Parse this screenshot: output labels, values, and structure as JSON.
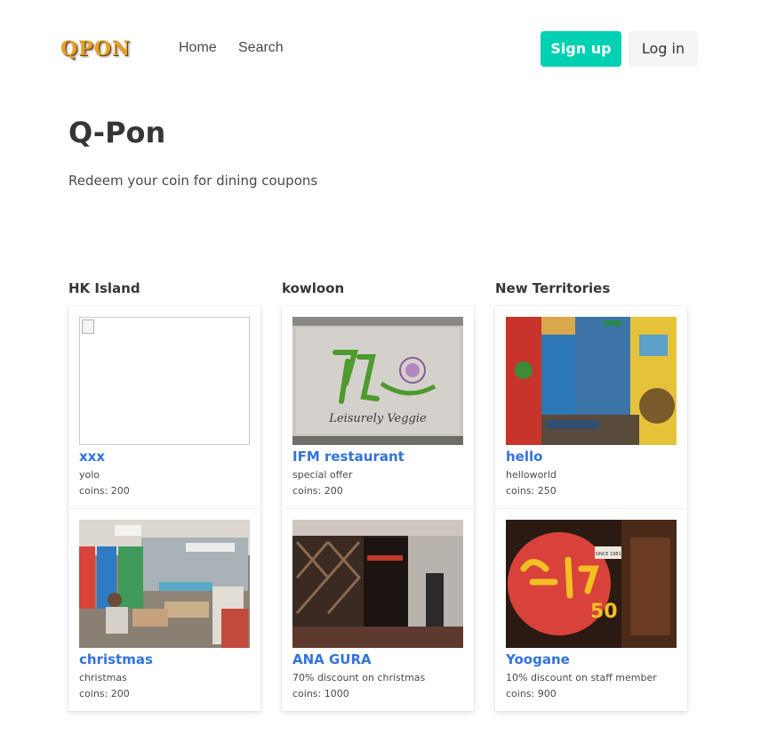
{
  "brand": {
    "logo_text": "QPON"
  },
  "nav": {
    "home": "Home",
    "search": "Search",
    "signup": "Sign up",
    "login": "Log in"
  },
  "hero": {
    "title": "Q-Pon",
    "subtitle": "Redeem your coin for dining coupons"
  },
  "columns": [
    {
      "title": "HK Island",
      "cards": [
        {
          "name": "xxx",
          "desc": "yolo",
          "coins": "coins: 200"
        },
        {
          "name": "christmas",
          "desc": "christmas",
          "coins": "coins: 200"
        }
      ]
    },
    {
      "title": "kowloon",
      "cards": [
        {
          "name": "IFM restaurant",
          "desc": "special offer",
          "coins": "coins: 200"
        },
        {
          "name": "ANA GURA",
          "desc": "70% discount on christmas",
          "coins": "coins: 1000"
        }
      ]
    },
    {
      "title": "New Territories",
      "cards": [
        {
          "name": "hello",
          "desc": "helloworld",
          "coins": "coins: 250"
        },
        {
          "name": "Yoogane",
          "desc": "10% discount on staff member",
          "coins": "coins: 900"
        }
      ]
    }
  ],
  "image_text": {
    "veggie_sign": "Leisurely Veggie",
    "yoogane_sign": "SINCE 1981"
  },
  "colors": {
    "accent": "#00d1b2",
    "link": "#3273dc",
    "heading": "#363636"
  }
}
